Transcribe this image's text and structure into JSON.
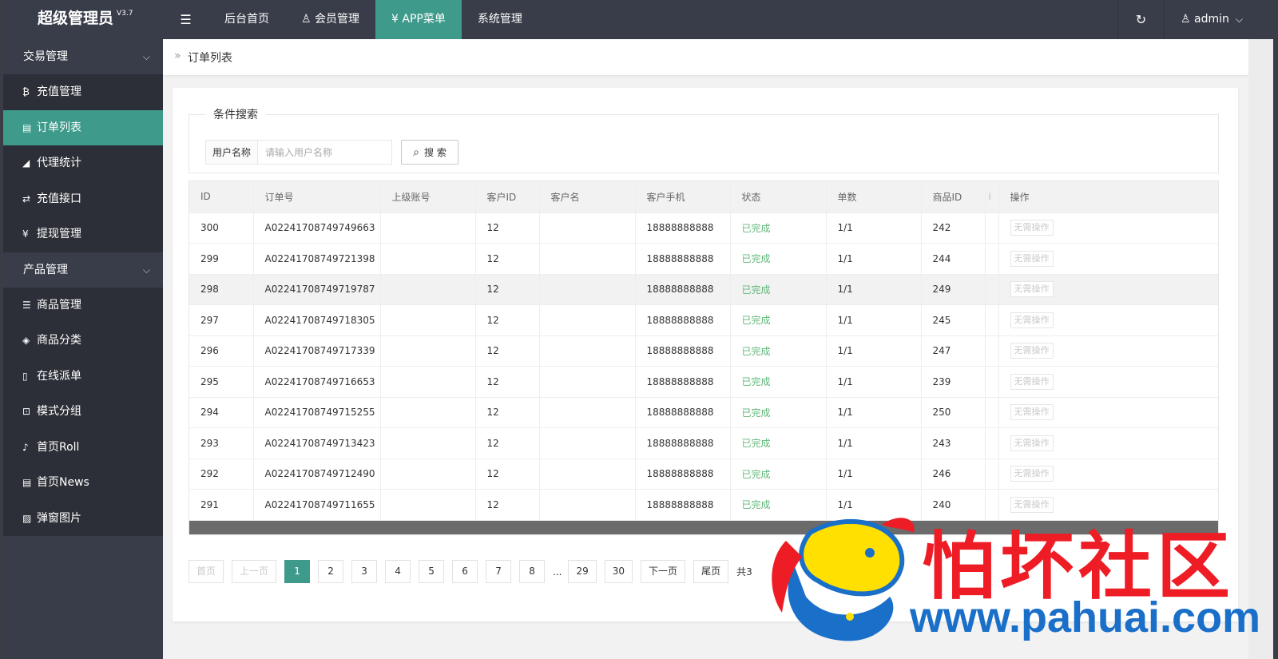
{
  "header": {
    "app_name": "超级管理员",
    "version": "V3.7",
    "toggle_icon": "☰",
    "nav": [
      {
        "label": "后台首页",
        "icon": ""
      },
      {
        "label": "会员管理",
        "icon": "♙"
      },
      {
        "label": "APP菜单",
        "icon": "¥"
      },
      {
        "label": "系统管理",
        "icon": ""
      }
    ],
    "refresh_icon": "↻",
    "user_icon": "♙",
    "user": "admin",
    "caret": "⌵"
  },
  "sidebar": {
    "groups": [
      {
        "label": "交易管理",
        "chevron": "⌵",
        "items": [
          {
            "label": "充值管理",
            "icon": "₿"
          },
          {
            "label": "订单列表",
            "icon": "▤"
          },
          {
            "label": "代理统计",
            "icon": "◢"
          },
          {
            "label": "充值接口",
            "icon": "⇄"
          },
          {
            "label": "提现管理",
            "icon": "¥"
          }
        ]
      },
      {
        "label": "产品管理",
        "chevron": "⌵",
        "items": [
          {
            "label": "商品管理",
            "icon": "☰"
          },
          {
            "label": "商品分类",
            "icon": "◈"
          },
          {
            "label": "在线派单",
            "icon": "▯"
          },
          {
            "label": "模式分组",
            "icon": "⊡"
          },
          {
            "label": "首页Roll",
            "icon": "♪"
          },
          {
            "label": "首页News",
            "icon": "▤"
          },
          {
            "label": "弹窗图片",
            "icon": "▨"
          }
        ]
      }
    ]
  },
  "breadcrumb": {
    "sep": "»",
    "current": "订单列表"
  },
  "search": {
    "legend": "条件搜索",
    "label": "用户名称",
    "placeholder": "请输入用户名称",
    "button": "搜 索",
    "button_icon": "⌕"
  },
  "table": {
    "columns": [
      "ID",
      "订单号",
      "上级账号",
      "客户ID",
      "客户名",
      "客户手机",
      "状态",
      "单数",
      "商品ID",
      "i",
      "操作"
    ],
    "rows": [
      {
        "id": "300",
        "order": "A02241708749749663",
        "parent": "",
        "cid": "12",
        "cname": "",
        "phone": "18888888888",
        "status": "已完成",
        "count": "1/1",
        "pid": "242",
        "extra": "",
        "op": "无需操作"
      },
      {
        "id": "299",
        "order": "A02241708749721398",
        "parent": "",
        "cid": "12",
        "cname": "",
        "phone": "18888888888",
        "status": "已完成",
        "count": "1/1",
        "pid": "244",
        "extra": "",
        "op": "无需操作"
      },
      {
        "id": "298",
        "order": "A02241708749719787",
        "parent": "",
        "cid": "12",
        "cname": "",
        "phone": "18888888888",
        "status": "已完成",
        "count": "1/1",
        "pid": "249",
        "extra": "",
        "op": "无需操作"
      },
      {
        "id": "297",
        "order": "A02241708749718305",
        "parent": "",
        "cid": "12",
        "cname": "",
        "phone": "18888888888",
        "status": "已完成",
        "count": "1/1",
        "pid": "245",
        "extra": "",
        "op": "无需操作"
      },
      {
        "id": "296",
        "order": "A02241708749717339",
        "parent": "",
        "cid": "12",
        "cname": "",
        "phone": "18888888888",
        "status": "已完成",
        "count": "1/1",
        "pid": "247",
        "extra": "",
        "op": "无需操作"
      },
      {
        "id": "295",
        "order": "A02241708749716653",
        "parent": "",
        "cid": "12",
        "cname": "",
        "phone": "18888888888",
        "status": "已完成",
        "count": "1/1",
        "pid": "239",
        "extra": "",
        "op": "无需操作"
      },
      {
        "id": "294",
        "order": "A02241708749715255",
        "parent": "",
        "cid": "12",
        "cname": "",
        "phone": "18888888888",
        "status": "已完成",
        "count": "1/1",
        "pid": "250",
        "extra": "",
        "op": "无需操作"
      },
      {
        "id": "293",
        "order": "A02241708749713423",
        "parent": "",
        "cid": "12",
        "cname": "",
        "phone": "18888888888",
        "status": "已完成",
        "count": "1/1",
        "pid": "243",
        "extra": "",
        "op": "无需操作"
      },
      {
        "id": "292",
        "order": "A02241708749712490",
        "parent": "",
        "cid": "12",
        "cname": "",
        "phone": "18888888888",
        "status": "已完成",
        "count": "1/1",
        "pid": "246",
        "extra": "",
        "op": "无需操作"
      },
      {
        "id": "291",
        "order": "A02241708749711655",
        "parent": "",
        "cid": "12",
        "cname": "",
        "phone": "18888888888",
        "status": "已完成",
        "count": "1/1",
        "pid": "240",
        "extra": "",
        "op": "无需操作"
      }
    ]
  },
  "pager": {
    "first": "首页",
    "prev": "上一页",
    "pages": [
      "1",
      "2",
      "3",
      "4",
      "5",
      "6",
      "7",
      "8"
    ],
    "ellipsis": "...",
    "tail_pages": [
      "29",
      "30"
    ],
    "next": "下一页",
    "last": "尾页",
    "total": "共3"
  },
  "watermark": {
    "text": "怕坏社区",
    "url": "www.pahuai.com"
  },
  "colors": {
    "accent": "#3e9a8b",
    "header_bg": "#393d49",
    "submenu_bg": "#2c2f37",
    "status_done": "#5fb878",
    "watermark_red": "#ee1c24",
    "watermark_blue": "#1a6fc9"
  }
}
